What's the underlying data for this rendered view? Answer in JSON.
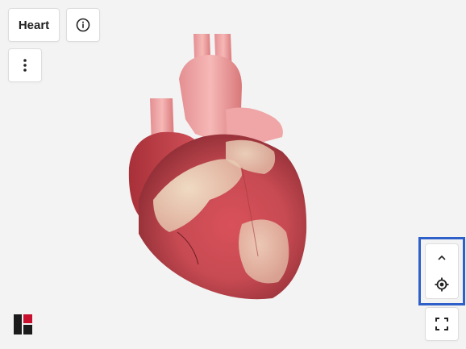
{
  "header": {
    "title": "Heart"
  },
  "icons": {
    "info": "info-icon",
    "more": "more-vertical-icon",
    "collapse": "chevron-up-icon",
    "recenter": "crosshair-target-icon",
    "fullscreen": "fullscreen-icon",
    "logo": "brand-logo-icon"
  },
  "colors": {
    "background": "#f3f3f3",
    "highlight_border": "#2f5fc9",
    "icon": "#222222",
    "logo_dark": "#1b1b1b",
    "logo_red": "#c8102e"
  }
}
